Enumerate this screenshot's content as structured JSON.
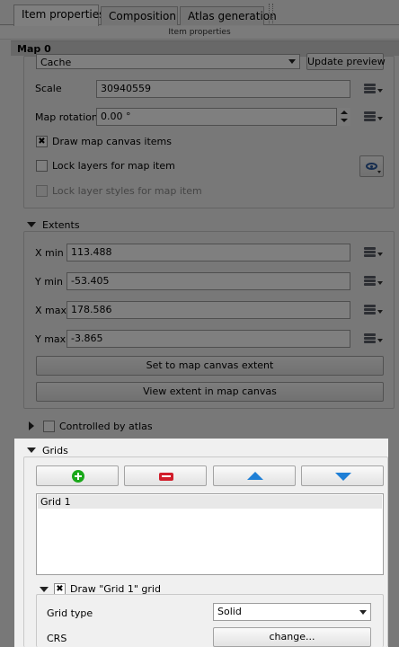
{
  "tabs": [
    "Item properties",
    "Composition",
    "Atlas generation"
  ],
  "subheader": "Item properties",
  "section_title": "Map 0",
  "cache": {
    "value": "Cache",
    "update_label": "Update preview"
  },
  "scale": {
    "label": "Scale",
    "value": "30940559"
  },
  "rotation": {
    "label": "Map rotation",
    "value": "0.00 °"
  },
  "draw_canvas_items": {
    "label": "Draw map canvas items",
    "checked": true
  },
  "lock_layers": {
    "label": "Lock layers for map item",
    "checked": false
  },
  "lock_styles": {
    "label": "Lock layer styles for map item",
    "checked": false
  },
  "extents": {
    "title": "Extents",
    "xmin": {
      "label": "X min",
      "value": "113.488"
    },
    "ymin": {
      "label": "Y min",
      "value": "-53.405"
    },
    "xmax": {
      "label": "X max",
      "value": "178.586"
    },
    "ymax": {
      "label": "Y max",
      "value": "-3.865"
    },
    "set_canvas_label": "Set to map canvas extent",
    "view_extent_label": "View extent in map canvas"
  },
  "atlas": {
    "label": "Controlled by atlas"
  },
  "grids": {
    "title": "Grids",
    "list": [
      "Grid 1"
    ],
    "draw_label": "Draw \"Grid 1\" grid",
    "grid_type": {
      "label": "Grid type",
      "value": "Solid"
    },
    "crs": {
      "label": "CRS",
      "button": "change..."
    }
  },
  "colors": {
    "accent_add": "#1aa81a",
    "accent_remove": "#d11d2a",
    "accent_arrow": "#1e7fd6"
  }
}
